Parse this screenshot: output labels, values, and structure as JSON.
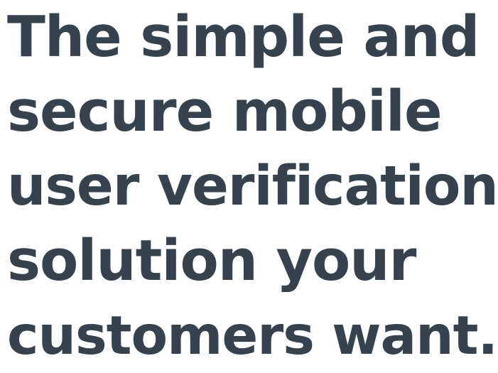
{
  "hero": {
    "lines": [
      "The simple and",
      "secure mobile",
      "user verification",
      "solution your",
      "customers want."
    ]
  },
  "colors": {
    "headline": "#36434f",
    "background": "#ffffff"
  }
}
